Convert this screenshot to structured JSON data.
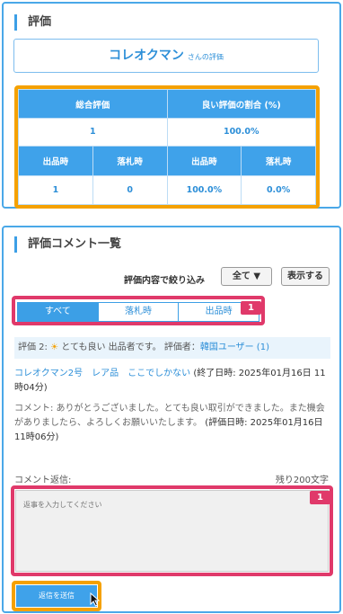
{
  "evaluation": {
    "section_title": "評価",
    "user_name": "コレオクマン",
    "user_suffix": "さんの評価",
    "table": {
      "h_total": "総合評価",
      "h_ratio": "良い評価の割合 (%)",
      "v_total": "1",
      "v_ratio": "100.0%",
      "h_seller": "出品時",
      "h_bidder": "落札時",
      "h_seller2": "出品時",
      "h_bidder2": "落札時",
      "v_seller": "1",
      "v_bidder": "0",
      "v_seller_ratio": "100.0%",
      "v_bidder_ratio": "0.0%"
    }
  },
  "comments": {
    "section_title": "評価コメント一覧",
    "filter_label": "評価内容で絞り込み",
    "filter_value": "全て ▼",
    "show_button": "表示する",
    "tabs": [
      {
        "label": "すべて",
        "active": true
      },
      {
        "label": "落札時",
        "active": false
      },
      {
        "label": "出品時",
        "active": false
      }
    ],
    "tabs_badge": "1",
    "info": {
      "rating_prefix": "評価 2:",
      "sun_icon": "☀",
      "rating_text": "とても良い 出品者です。 評価者：",
      "rater": "韓国ユーザー (1)"
    },
    "item": {
      "title": "コレオクマン2号　レア品　ここでしかない",
      "end_date": "(終了日時: 2025年01月16日 11時04分)"
    },
    "comment": {
      "text": "コメント: ありがとうございました。とても良い取引ができました。また機会がありましたら、よろしくお願いいたします。",
      "date": "(評価日時: 2025年01月16日 11時06分)"
    },
    "reply": {
      "label": "コメント返信:",
      "remaining": "残り200文字",
      "placeholder": "返事を入力してください",
      "badge": "1",
      "send_button": "返信を送信"
    }
  },
  "colors": {
    "accent": "#3c9fe6",
    "highlight_red": "#e0396a",
    "highlight_orange": "#f5a100"
  }
}
